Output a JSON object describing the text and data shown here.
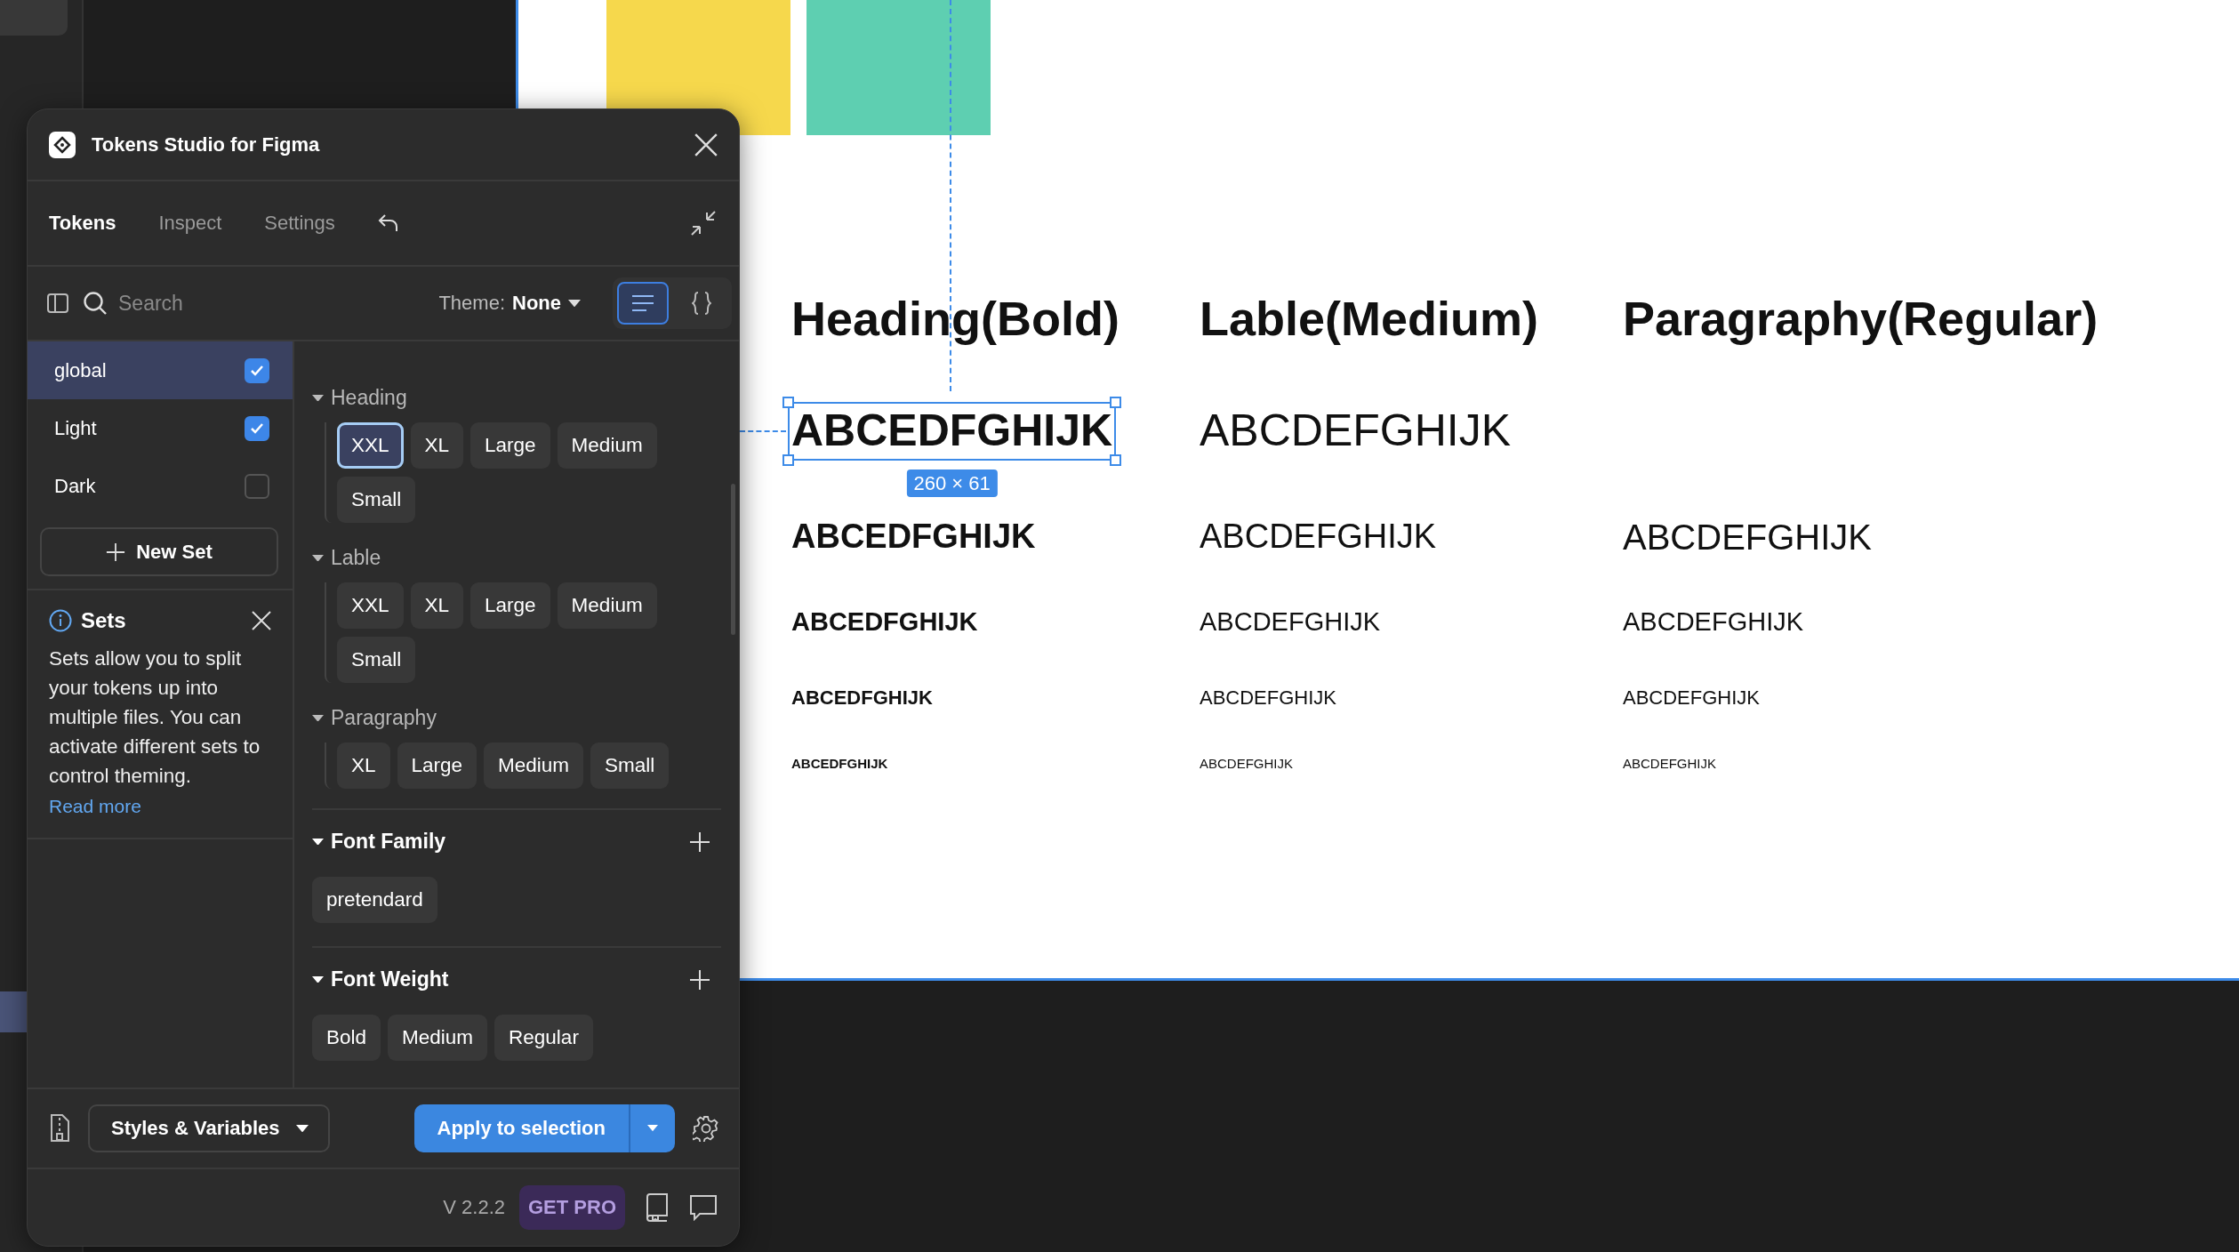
{
  "canvas": {
    "selection_label": "260 × 61",
    "columns": [
      {
        "title": "Heading(Bold)",
        "kind": "bold",
        "samples": [
          {
            "kind": "xxl",
            "text": "ABCEDFGHIJK",
            "selected": true
          },
          {
            "kind": "xl",
            "text": "ABCEDFGHIJK",
            "selected": false
          },
          {
            "kind": "large",
            "text": "ABCEDFGHIJK",
            "selected": false
          },
          {
            "kind": "medium",
            "text": "ABCEDFGHIJK",
            "selected": false
          },
          {
            "kind": "small",
            "text": "ABCEDFGHIJK",
            "selected": false
          }
        ]
      },
      {
        "title": "Lable(Medium)",
        "kind": "medium",
        "samples": [
          {
            "kind": "xxl",
            "text": "ABCDEFGHIJK",
            "selected": false
          },
          {
            "kind": "xl",
            "text": "ABCDEFGHIJK",
            "selected": false
          },
          {
            "kind": "large",
            "text": "ABCDEFGHIJK",
            "selected": false
          },
          {
            "kind": "medium",
            "text": "ABCDEFGHIJK",
            "selected": false
          },
          {
            "kind": "small",
            "text": "ABCDEFGHIJK",
            "selected": false
          }
        ]
      },
      {
        "title": "Paragraphy(Regular)",
        "kind": "regular",
        "samples": [
          {
            "kind": "xl",
            "text": "ABCDEFGHIJK",
            "selected": false
          },
          {
            "kind": "large",
            "text": "ABCDEFGHIJK",
            "selected": false
          },
          {
            "kind": "medium",
            "text": "ABCDEFGHIJK",
            "selected": false
          },
          {
            "kind": "small",
            "text": "ABCDEFGHIJK",
            "selected": false
          }
        ]
      }
    ]
  },
  "plugin": {
    "title": "Tokens Studio for Figma",
    "tabs": [
      {
        "label": "Tokens",
        "selected": true
      },
      {
        "label": "Inspect",
        "selected": false
      },
      {
        "label": "Settings",
        "selected": false
      }
    ],
    "search": {
      "placeholder": "Search"
    },
    "theme": {
      "label": "Theme:",
      "value": "None"
    },
    "view_modes": [
      {
        "kind": "list",
        "selected": true
      },
      {
        "kind": "json",
        "selected": false
      }
    ],
    "sets": [
      {
        "name": "global",
        "selected": true,
        "checked": true
      },
      {
        "name": "Light",
        "selected": false,
        "checked": true
      },
      {
        "name": "Dark",
        "selected": false,
        "checked": false
      }
    ],
    "new_set_button": "New Set",
    "sets_info": {
      "title": "Sets",
      "text": "Sets allow you to split your tokens up into multiple files. You can activate different sets to control theming.",
      "link": "Read more"
    },
    "typography_groups": [
      {
        "title": "Heading",
        "expanded": true,
        "tokens": [
          {
            "label": "XXL",
            "selected": true
          },
          {
            "label": "XL",
            "selected": false
          },
          {
            "label": "Large",
            "selected": false
          },
          {
            "label": "Medium",
            "selected": false
          },
          {
            "label": "Small",
            "selected": false
          }
        ]
      },
      {
        "title": "Lable",
        "expanded": true,
        "tokens": [
          {
            "label": "XXL",
            "selected": false
          },
          {
            "label": "XL",
            "selected": false
          },
          {
            "label": "Large",
            "selected": false
          },
          {
            "label": "Medium",
            "selected": false
          },
          {
            "label": "Small",
            "selected": false
          }
        ]
      },
      {
        "title": "Paragraphy",
        "expanded": true,
        "tokens": [
          {
            "label": "XL",
            "selected": false
          },
          {
            "label": "Large",
            "selected": false
          },
          {
            "label": "Medium",
            "selected": false
          },
          {
            "label": "Small",
            "selected": false
          }
        ]
      }
    ],
    "sections": [
      {
        "title": "Font Family",
        "expanded": true,
        "tokens": [
          {
            "label": "pretendard",
            "selected": false
          }
        ]
      },
      {
        "title": "Font Weight",
        "expanded": true,
        "tokens": [
          {
            "label": "Bold",
            "selected": false
          },
          {
            "label": "Medium",
            "selected": false
          },
          {
            "label": "Regular",
            "selected": false
          }
        ]
      }
    ],
    "footer": {
      "mode": "Styles & Variables",
      "apply_button": "Apply to selection",
      "version": "V 2.2.2",
      "pro_button": "GET PRO"
    }
  }
}
